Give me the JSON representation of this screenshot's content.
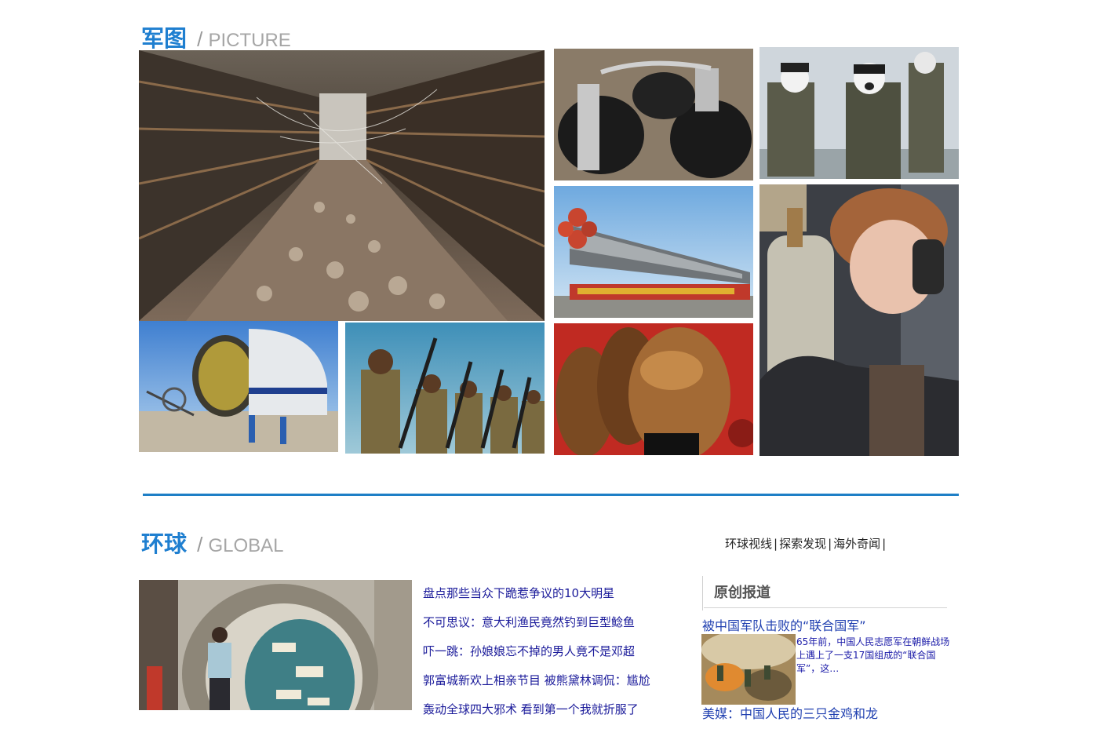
{
  "picture_section": {
    "title_cn": "军图",
    "slash": "/",
    "title_en": "PICTURE",
    "photos": [
      {
        "name": "photo-abandoned-store",
        "desc_icon": "shelves-image"
      },
      {
        "name": "photo-grenades",
        "desc_icon": "grenades-image"
      },
      {
        "name": "photo-facepaint-soldiers",
        "desc_icon": "soldiers-image"
      },
      {
        "name": "photo-rocket-transport",
        "desc_icon": "rocket-image"
      },
      {
        "name": "photo-female-sailor",
        "desc_icon": "sailor-image"
      },
      {
        "name": "photo-cargo-plane",
        "desc_icon": "plane-image"
      },
      {
        "name": "photo-soldiers-rifles",
        "desc_icon": "rifles-image"
      },
      {
        "name": "photo-bodybuilders",
        "desc_icon": "bodybuilder-image"
      }
    ]
  },
  "global_section": {
    "title_cn": "环球",
    "slash": "/",
    "title_en": "GLOBAL",
    "nav": [
      "环球视线",
      "探索发现",
      "海外奇闻"
    ],
    "nav_sep": "|",
    "news": [
      "盘点那些当众下跪惹争议的10大明星",
      "不可思议：意大利渔民竟然钓到巨型鲶鱼",
      "吓一跳：孙娘娘忘不掉的男人竟不是邓超",
      "郭富城新欢上相亲节目  被熊黛林调侃：尴尬",
      "轰动全球四大邪术  看到第一个我就折服了"
    ],
    "original": {
      "heading": "原创报道",
      "title": "被中国军队击败的“联合国军”",
      "desc": "65年前，中国人民志愿军在朝鲜战场上遇上了一支17国组成的“联合国军”，这…",
      "next_title": "美媒：中国人民的三只金鸡和龙"
    }
  },
  "colors": {
    "accent": "#1f7fd0",
    "divider": "#1e7fc6",
    "link": "#1a1a9a"
  }
}
